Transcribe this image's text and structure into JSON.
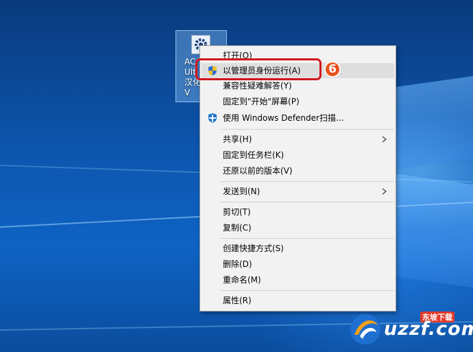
{
  "desktop_icon": {
    "label": "AC\nUlti\n汉化\nV"
  },
  "annotation": {
    "step": "6"
  },
  "menu": {
    "items": [
      {
        "label": "打开(O)"
      },
      {
        "label": "以管理员身份运行(A)"
      },
      {
        "label": "兼容性疑难解答(Y)"
      },
      {
        "label": "固定到\"开始\"屏幕(P)"
      },
      {
        "label": "使用 Windows Defender扫描..."
      },
      {
        "label": "共享(H)"
      },
      {
        "label": "固定到任务栏(K)"
      },
      {
        "label": "还原以前的版本(V)"
      },
      {
        "label": "发送到(N)"
      },
      {
        "label": "剪切(T)"
      },
      {
        "label": "复制(C)"
      },
      {
        "label": "创建快捷方式(S)"
      },
      {
        "label": "删除(D)"
      },
      {
        "label": "重命名(M)"
      },
      {
        "label": "属性(R)"
      }
    ]
  },
  "watermark": {
    "text": "uzzf.com",
    "sub": "东坡下载"
  }
}
